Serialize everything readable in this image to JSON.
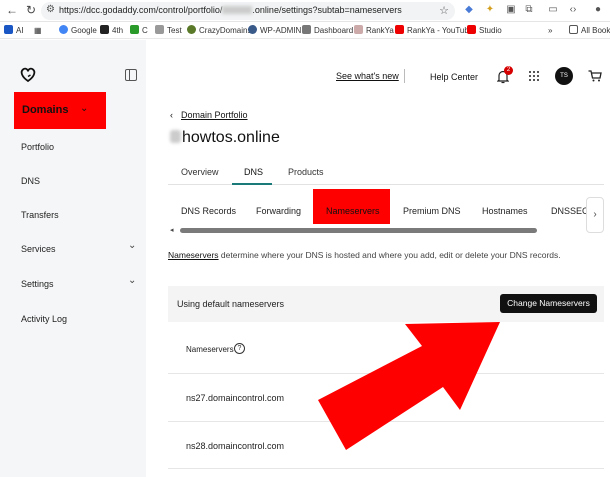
{
  "browser": {
    "url": "https://dcc.godaddy.com/control/portfolio/",
    "url_tail": ".online/settings?subtab=nameservers",
    "bookmarks": [
      "AI",
      "Google",
      "4th",
      "C",
      "Test",
      "CrazyDomains",
      "WP-ADMIN",
      "Dashboard",
      "RankYa",
      "RankYa - YouTube",
      "Studio",
      "All Book"
    ]
  },
  "sidebar": {
    "domains_label": "Domains",
    "items": [
      {
        "label": "Portfolio"
      },
      {
        "label": "DNS"
      },
      {
        "label": "Transfers"
      },
      {
        "label": "Services"
      },
      {
        "label": "Settings"
      },
      {
        "label": "Activity Log"
      }
    ]
  },
  "header": {
    "whats_new": "See what's new",
    "help_center": "Help Center",
    "notification_count": "2",
    "avatar_initials": "TS"
  },
  "main": {
    "back_link": "Domain Portfolio",
    "domain_title": "howtos.online",
    "tabs": [
      "Overview",
      "DNS",
      "Products"
    ],
    "subtabs": [
      "DNS Records",
      "Forwarding",
      "Nameservers",
      "Premium DNS",
      "Hostnames",
      "DNSSEC"
    ],
    "description_link": "Nameservers",
    "description_rest": " determine where your DNS is hosted and where you add, edit or delete your DNS records.",
    "using_default": "Using default nameservers",
    "change_button": "Change Nameservers",
    "ns_header": "Nameservers",
    "nameservers": [
      "ns27.domaincontrol.com",
      "ns28.domaincontrol.com"
    ]
  },
  "colors": {
    "highlight": "#ff0000",
    "button": "#111111",
    "tab_underline": "#1a7a7a"
  }
}
